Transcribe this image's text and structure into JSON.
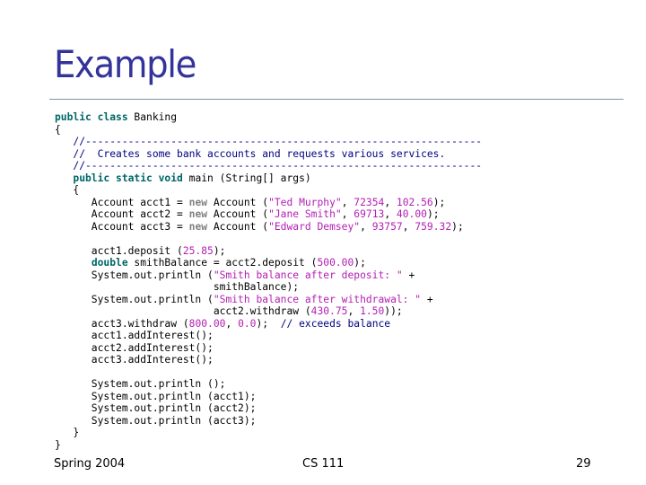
{
  "slide": {
    "title": "Example",
    "footer": {
      "left": "Spring 2004",
      "center": "CS 111",
      "page_number": "29"
    }
  },
  "code_lines": [
    [
      {
        "t": "kw",
        "v": "public class"
      },
      {
        "t": "pl",
        "v": " Banking"
      }
    ],
    [
      {
        "t": "pl",
        "v": "{"
      }
    ],
    [
      {
        "t": "cm",
        "v": "   //-----------------------------------------------------------------"
      }
    ],
    [
      {
        "t": "cm",
        "v": "   //  Creates some bank accounts and requests various services."
      }
    ],
    [
      {
        "t": "cm",
        "v": "   //-----------------------------------------------------------------"
      }
    ],
    [
      {
        "t": "pl",
        "v": "   "
      },
      {
        "t": "kw",
        "v": "public static void"
      },
      {
        "t": "pl",
        "v": " main (String[] args)"
      }
    ],
    [
      {
        "t": "pl",
        "v": "   {"
      }
    ],
    [
      {
        "t": "pl",
        "v": "      Account acct1 = "
      },
      {
        "t": "kg",
        "v": "new"
      },
      {
        "t": "pl",
        "v": " Account ("
      },
      {
        "t": "st",
        "v": "\"Ted Murphy\""
      },
      {
        "t": "pl",
        "v": ", "
      },
      {
        "t": "nm",
        "v": "72354"
      },
      {
        "t": "pl",
        "v": ", "
      },
      {
        "t": "nm",
        "v": "102.56"
      },
      {
        "t": "pl",
        "v": ");"
      }
    ],
    [
      {
        "t": "pl",
        "v": "      Account acct2 = "
      },
      {
        "t": "kg",
        "v": "new"
      },
      {
        "t": "pl",
        "v": " Account ("
      },
      {
        "t": "st",
        "v": "\"Jane Smith\""
      },
      {
        "t": "pl",
        "v": ", "
      },
      {
        "t": "nm",
        "v": "69713"
      },
      {
        "t": "pl",
        "v": ", "
      },
      {
        "t": "nm",
        "v": "40.00"
      },
      {
        "t": "pl",
        "v": ");"
      }
    ],
    [
      {
        "t": "pl",
        "v": "      Account acct3 = "
      },
      {
        "t": "kg",
        "v": "new"
      },
      {
        "t": "pl",
        "v": " Account ("
      },
      {
        "t": "st",
        "v": "\"Edward Demsey\""
      },
      {
        "t": "pl",
        "v": ", "
      },
      {
        "t": "nm",
        "v": "93757"
      },
      {
        "t": "pl",
        "v": ", "
      },
      {
        "t": "nm",
        "v": "759.32"
      },
      {
        "t": "pl",
        "v": ");"
      }
    ],
    [
      {
        "t": "pl",
        "v": ""
      }
    ],
    [
      {
        "t": "pl",
        "v": "      acct1.deposit ("
      },
      {
        "t": "nm",
        "v": "25.85"
      },
      {
        "t": "pl",
        "v": ");"
      }
    ],
    [
      {
        "t": "pl",
        "v": "      "
      },
      {
        "t": "kw",
        "v": "double"
      },
      {
        "t": "pl",
        "v": " smithBalance = acct2.deposit ("
      },
      {
        "t": "nm",
        "v": "500.00"
      },
      {
        "t": "pl",
        "v": ");"
      }
    ],
    [
      {
        "t": "pl",
        "v": "      System.out.println ("
      },
      {
        "t": "st",
        "v": "\"Smith balance after deposit: \""
      },
      {
        "t": "pl",
        "v": " +"
      }
    ],
    [
      {
        "t": "pl",
        "v": "                          smithBalance);"
      }
    ],
    [
      {
        "t": "pl",
        "v": "      System.out.println ("
      },
      {
        "t": "st",
        "v": "\"Smith balance after withdrawal: \""
      },
      {
        "t": "pl",
        "v": " +"
      }
    ],
    [
      {
        "t": "pl",
        "v": "                          acct2.withdraw ("
      },
      {
        "t": "nm",
        "v": "430.75"
      },
      {
        "t": "pl",
        "v": ", "
      },
      {
        "t": "nm",
        "v": "1.50"
      },
      {
        "t": "pl",
        "v": "));"
      }
    ],
    [
      {
        "t": "pl",
        "v": "      acct3.withdraw ("
      },
      {
        "t": "nm",
        "v": "800.00"
      },
      {
        "t": "pl",
        "v": ", "
      },
      {
        "t": "nm",
        "v": "0.0"
      },
      {
        "t": "pl",
        "v": ");  "
      },
      {
        "t": "cm",
        "v": "// exceeds balance"
      }
    ],
    [
      {
        "t": "pl",
        "v": "      acct1.addInterest();"
      }
    ],
    [
      {
        "t": "pl",
        "v": "      acct2.addInterest();"
      }
    ],
    [
      {
        "t": "pl",
        "v": "      acct3.addInterest();"
      }
    ],
    [
      {
        "t": "pl",
        "v": ""
      }
    ],
    [
      {
        "t": "pl",
        "v": "      System.out.println ();"
      }
    ],
    [
      {
        "t": "pl",
        "v": "      System.out.println (acct1);"
      }
    ],
    [
      {
        "t": "pl",
        "v": "      System.out.println (acct2);"
      }
    ],
    [
      {
        "t": "pl",
        "v": "      System.out.println (acct3);"
      }
    ],
    [
      {
        "t": "pl",
        "v": "   }"
      }
    ],
    [
      {
        "t": "pl",
        "v": "}"
      }
    ]
  ],
  "colors": {
    "title": "#333399",
    "keyword": "#006666",
    "new_keyword": "#808080",
    "comment": "#000080",
    "literal": "#b31fb3",
    "rule": "#7f97a8"
  }
}
